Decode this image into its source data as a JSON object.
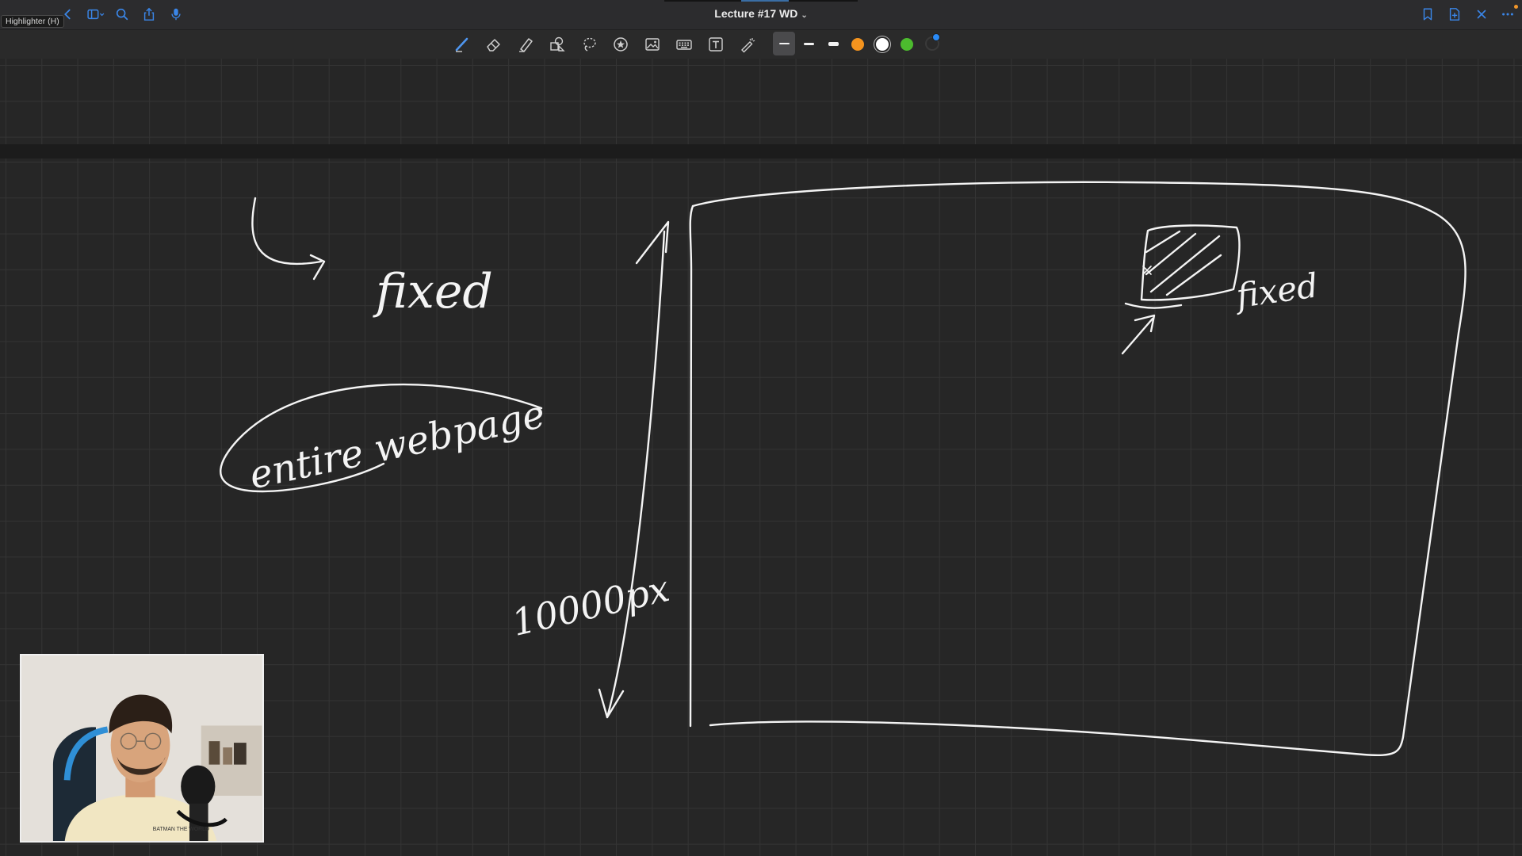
{
  "window": {
    "title": "Lecture #17 WD",
    "title_chevron": "⌄",
    "tooltip": "Highlighter (H)"
  },
  "titlebar_left_icons": [
    "back-chevron-icon",
    "sidebar-toggle-icon",
    "search-icon",
    "share-icon",
    "microphone-icon"
  ],
  "titlebar_right_icons": [
    "bookmark-icon",
    "add-page-icon",
    "close-icon",
    "more-options-icon"
  ],
  "toolbar": {
    "tools": [
      "pen",
      "eraser",
      "highlighter",
      "shapes",
      "lasso",
      "sticker",
      "image",
      "keyboard",
      "text-box",
      "laser-pointer"
    ],
    "selected_tool": "pen",
    "stroke_widths": [
      "thin",
      "medium",
      "thick"
    ],
    "selected_stroke": "thin",
    "colors": [
      "#f5941e",
      "#ffffff",
      "#4cbb2e"
    ],
    "selected_color": "#ffffff",
    "picker_accent": "#2a8af6"
  },
  "canvas": {
    "background": "#262626",
    "grid_color": "#343434",
    "ink_color": "#f4f4f4",
    "handwriting": {
      "fixed_left": "fixed",
      "entire_webpage": "entire webpage",
      "height_label": "10000px",
      "fixed_right": "fixed"
    }
  },
  "webcam": {
    "shirt_text": "BATMAN THE WORLD"
  }
}
